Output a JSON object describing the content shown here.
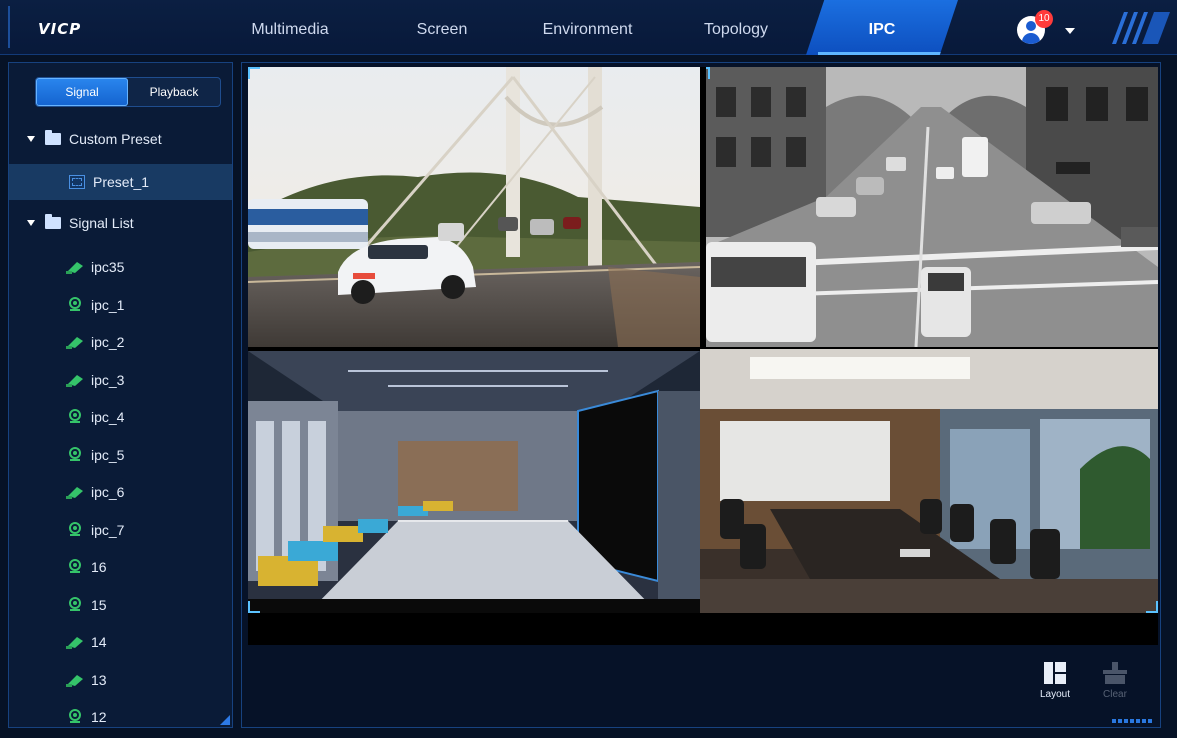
{
  "app": {
    "logo": "VICP"
  },
  "nav": {
    "items": [
      {
        "label": "Multimedia",
        "active": false
      },
      {
        "label": "Screen",
        "active": false
      },
      {
        "label": "Environment",
        "active": false
      },
      {
        "label": "Topology",
        "active": false
      },
      {
        "label": "IPC",
        "active": true
      }
    ]
  },
  "user": {
    "notification_count": "10",
    "avatar_icon": "user-avatar-icon"
  },
  "sidebar": {
    "tabs": [
      {
        "label": "Signal",
        "active": true
      },
      {
        "label": "Playback",
        "active": false
      }
    ],
    "custom_preset": {
      "label": "Custom Preset",
      "expanded": true,
      "items": [
        {
          "label": "Preset_1",
          "selected": true
        }
      ]
    },
    "signal_list": {
      "label": "Signal List",
      "expanded": true,
      "items": [
        {
          "label": "ipc35",
          "icon": "bullet-camera-icon"
        },
        {
          "label": "ipc_1",
          "icon": "dome-camera-icon"
        },
        {
          "label": "ipc_2",
          "icon": "bullet-camera-icon"
        },
        {
          "label": "ipc_3",
          "icon": "bullet-camera-icon"
        },
        {
          "label": "ipc_4",
          "icon": "dome-camera-icon"
        },
        {
          "label": "ipc_5",
          "icon": "dome-camera-icon"
        },
        {
          "label": "ipc_6",
          "icon": "bullet-camera-icon"
        },
        {
          "label": "ipc_7",
          "icon": "dome-camera-icon"
        },
        {
          "label": "16",
          "icon": "dome-camera-icon"
        },
        {
          "label": "15",
          "icon": "dome-camera-icon"
        },
        {
          "label": "14",
          "icon": "bullet-camera-icon"
        },
        {
          "label": "13",
          "icon": "bullet-camera-icon"
        },
        {
          "label": "12",
          "icon": "dome-camera-icon"
        }
      ]
    }
  },
  "video_wall": {
    "tiles": [
      {
        "scene": "bridge-traffic-feed"
      },
      {
        "scene": "city-street-bw-feed"
      },
      {
        "scene": "office-lobby-feed"
      },
      {
        "scene": "meeting-room-feed"
      }
    ]
  },
  "toolbar": {
    "layout": {
      "label": "Layout",
      "enabled": true
    },
    "clear": {
      "label": "Clear",
      "enabled": false
    }
  },
  "colors": {
    "accent": "#1b6fe0",
    "camera_green": "#35c46a",
    "background": "#061226",
    "panel": "#0a1b37"
  }
}
